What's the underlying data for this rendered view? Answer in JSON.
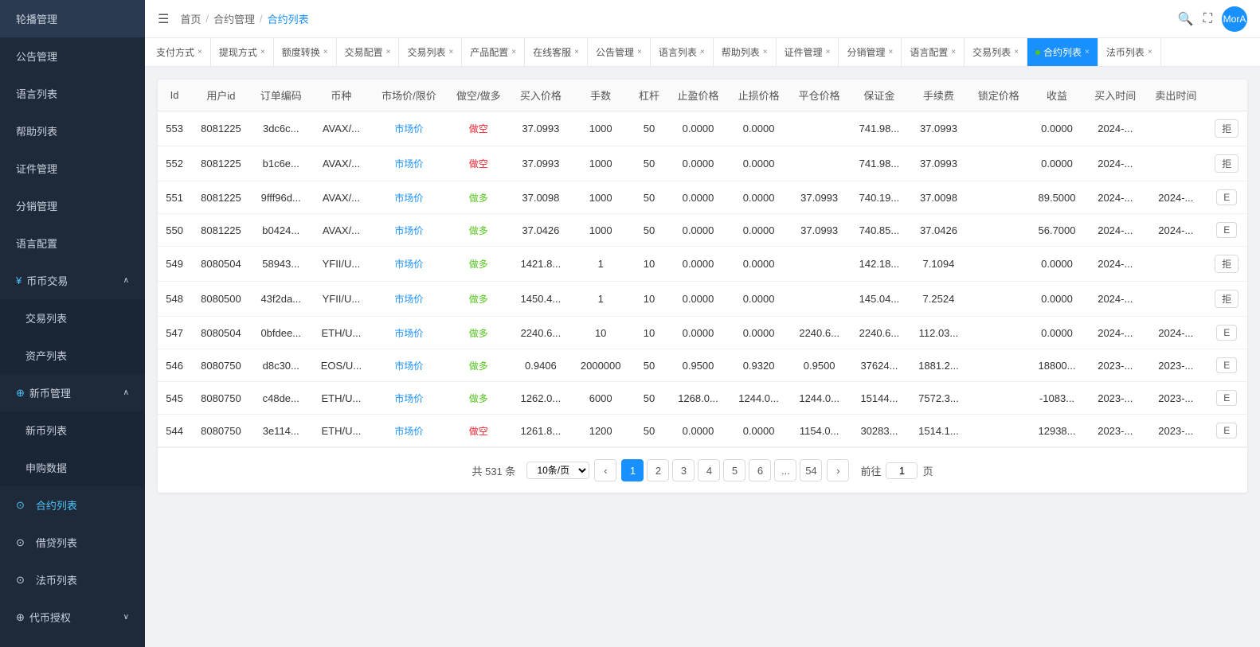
{
  "sidebar": {
    "items": [
      {
        "label": "轮播管理",
        "key": "banner",
        "active": false
      },
      {
        "label": "公告管理",
        "key": "notice",
        "active": false
      },
      {
        "label": "语言列表",
        "key": "language-list",
        "active": false
      },
      {
        "label": "帮助列表",
        "key": "help-list",
        "active": false
      },
      {
        "label": "证件管理",
        "key": "cert",
        "active": false
      },
      {
        "label": "分销管理",
        "key": "distribution",
        "active": false
      },
      {
        "label": "语言配置",
        "key": "lang-config",
        "active": false
      }
    ],
    "sections": [
      {
        "label": "币币交易",
        "key": "coin-trade",
        "expanded": true,
        "sub": [
          {
            "label": "交易列表",
            "key": "trade-list",
            "active": false
          },
          {
            "label": "资产列表",
            "key": "asset-list",
            "active": false
          }
        ]
      },
      {
        "label": "新币管理",
        "key": "new-coin",
        "expanded": true,
        "sub": [
          {
            "label": "新币列表",
            "key": "new-coin-list",
            "active": false
          },
          {
            "label": "申购数据",
            "key": "subscribe-data",
            "active": false
          }
        ]
      },
      {
        "label": "合约列表",
        "key": "contract-list-menu",
        "active": true
      },
      {
        "label": "借贷列表",
        "key": "loan-list"
      },
      {
        "label": "法币列表",
        "key": "fiat-list"
      },
      {
        "label": "代币授权",
        "key": "token-auth",
        "expanded": false
      }
    ]
  },
  "topbar": {
    "breadcrumbs": [
      "首页",
      "合约管理",
      "合约列表"
    ],
    "search_icon": "🔍",
    "fullscreen_icon": "⛶",
    "user_label": "MorA"
  },
  "tabs": [
    {
      "label": "支付方式",
      "active": false
    },
    {
      "label": "提现方式",
      "active": false
    },
    {
      "label": "额度转换",
      "active": false
    },
    {
      "label": "交易配置",
      "active": false
    },
    {
      "label": "交易列表",
      "active": false
    },
    {
      "label": "产品配置",
      "active": false
    },
    {
      "label": "在线客服",
      "active": false
    },
    {
      "label": "公告管理",
      "active": false
    },
    {
      "label": "语言列表",
      "active": false
    },
    {
      "label": "帮助列表",
      "active": false
    },
    {
      "label": "证件管理",
      "active": false
    },
    {
      "label": "分销管理",
      "active": false
    },
    {
      "label": "语言配置",
      "active": false
    },
    {
      "label": "交易列表",
      "active": false
    },
    {
      "label": "合约列表",
      "active": true,
      "dot": true
    },
    {
      "label": "法币列表",
      "active": false
    }
  ],
  "table": {
    "columns": [
      "Id",
      "用户id",
      "订单编码",
      "币种",
      "市场价/限价",
      "做空/做多",
      "买入价格",
      "手数",
      "杠杆",
      "止盈价格",
      "止损价格",
      "平仓价格",
      "保证金",
      "手续费",
      "锁定价格",
      "收益",
      "买入时间",
      "卖出时间"
    ],
    "rows": [
      {
        "id": "553",
        "user_id": "8081225",
        "order_code": "3dc6c...",
        "coin": "AVAX/...",
        "price_type": "市场价",
        "direction": "做空",
        "direction_type": "short",
        "buy_price": "37.0993",
        "lots": "1000",
        "leverage": "50",
        "stop_profit": "0.0000",
        "stop_loss": "0.0000",
        "close_price": "",
        "margin": "741.98...",
        "fee": "37.0993",
        "lock_price": "",
        "profit": "0.0000",
        "buy_time": "2024-...",
        "sell_time": "",
        "action": "拒"
      },
      {
        "id": "552",
        "user_id": "8081225",
        "order_code": "b1c6e...",
        "coin": "AVAX/...",
        "price_type": "市场价",
        "direction": "做空",
        "direction_type": "short",
        "buy_price": "37.0993",
        "lots": "1000",
        "leverage": "50",
        "stop_profit": "0.0000",
        "stop_loss": "0.0000",
        "close_price": "",
        "margin": "741.98...",
        "fee": "37.0993",
        "lock_price": "",
        "profit": "0.0000",
        "buy_time": "2024-...",
        "sell_time": "",
        "action": "拒"
      },
      {
        "id": "551",
        "user_id": "8081225",
        "order_code": "9fff96d...",
        "coin": "AVAX/...",
        "price_type": "市场价",
        "direction": "做多",
        "direction_type": "long",
        "buy_price": "37.0098",
        "lots": "1000",
        "leverage": "50",
        "stop_profit": "0.0000",
        "stop_loss": "0.0000",
        "close_price": "37.0993",
        "margin": "740.19...",
        "fee": "37.0098",
        "lock_price": "",
        "profit": "89.5000",
        "buy_time": "2024-...",
        "sell_time": "2024-...",
        "action": "E"
      },
      {
        "id": "550",
        "user_id": "8081225",
        "order_code": "b0424...",
        "coin": "AVAX/...",
        "price_type": "市场价",
        "direction": "做多",
        "direction_type": "long",
        "buy_price": "37.0426",
        "lots": "1000",
        "leverage": "50",
        "stop_profit": "0.0000",
        "stop_loss": "0.0000",
        "close_price": "37.0993",
        "margin": "740.85...",
        "fee": "37.0426",
        "lock_price": "",
        "profit": "56.7000",
        "buy_time": "2024-...",
        "sell_time": "2024-...",
        "action": "E"
      },
      {
        "id": "549",
        "user_id": "8080504",
        "order_code": "58943...",
        "coin": "YFII/U...",
        "price_type": "市场价",
        "direction": "做多",
        "direction_type": "long",
        "buy_price": "1421.8...",
        "lots": "1",
        "leverage": "10",
        "stop_profit": "0.0000",
        "stop_loss": "0.0000",
        "close_price": "",
        "margin": "142.18...",
        "fee": "7.1094",
        "lock_price": "",
        "profit": "0.0000",
        "buy_time": "2024-...",
        "sell_time": "",
        "action": "拒"
      },
      {
        "id": "548",
        "user_id": "8080500",
        "order_code": "43f2da...",
        "coin": "YFII/U...",
        "price_type": "市场价",
        "direction": "做多",
        "direction_type": "long",
        "buy_price": "1450.4...",
        "lots": "1",
        "leverage": "10",
        "stop_profit": "0.0000",
        "stop_loss": "0.0000",
        "close_price": "",
        "margin": "145.04...",
        "fee": "7.2524",
        "lock_price": "",
        "profit": "0.0000",
        "buy_time": "2024-...",
        "sell_time": "",
        "action": "拒"
      },
      {
        "id": "547",
        "user_id": "8080504",
        "order_code": "0bfdee...",
        "coin": "ETH/U...",
        "price_type": "市场价",
        "direction": "做多",
        "direction_type": "long",
        "buy_price": "2240.6...",
        "lots": "10",
        "leverage": "10",
        "stop_profit": "0.0000",
        "stop_loss": "0.0000",
        "close_price": "2240.6...",
        "margin": "2240.6...",
        "fee": "112.03...",
        "lock_price": "",
        "profit": "0.0000",
        "buy_time": "2024-...",
        "sell_time": "2024-...",
        "action": "E"
      },
      {
        "id": "546",
        "user_id": "8080750",
        "order_code": "d8c30...",
        "coin": "EOS/U...",
        "price_type": "市场价",
        "direction": "做多",
        "direction_type": "long",
        "buy_price": "0.9406",
        "lots": "2000000",
        "leverage": "50",
        "stop_profit": "0.9500",
        "stop_loss": "0.9320",
        "close_price": "0.9500",
        "margin": "37624...",
        "fee": "1881.2...",
        "lock_price": "",
        "profit": "18800...",
        "buy_time": "2023-...",
        "sell_time": "2023-...",
        "action": "E"
      },
      {
        "id": "545",
        "user_id": "8080750",
        "order_code": "c48de...",
        "coin": "ETH/U...",
        "price_type": "市场价",
        "direction": "做多",
        "direction_type": "long",
        "buy_price": "1262.0...",
        "lots": "6000",
        "leverage": "50",
        "stop_profit": "1268.0...",
        "stop_loss": "1244.0...",
        "close_price": "1244.0...",
        "margin": "15144...",
        "fee": "7572.3...",
        "lock_price": "",
        "profit": "-1083...",
        "buy_time": "2023-...",
        "sell_time": "2023-...",
        "action": "E"
      },
      {
        "id": "544",
        "user_id": "8080750",
        "order_code": "3e114...",
        "coin": "ETH/U...",
        "price_type": "市场价",
        "direction": "做空",
        "direction_type": "short",
        "buy_price": "1261.8...",
        "lots": "1200",
        "leverage": "50",
        "stop_profit": "0.0000",
        "stop_loss": "0.0000",
        "close_price": "1154.0...",
        "margin": "30283...",
        "fee": "1514.1...",
        "lock_price": "",
        "profit": "12938...",
        "buy_time": "2023-...",
        "sell_time": "2023-...",
        "action": "E"
      }
    ]
  },
  "pagination": {
    "total_text": "共 531 条",
    "page_size_label": "10条/页",
    "prev_icon": "‹",
    "next_icon": "›",
    "pages": [
      "1",
      "2",
      "3",
      "4",
      "5",
      "6",
      "...",
      "54"
    ],
    "current_page": "1",
    "jump_label_before": "前往",
    "jump_value": "1",
    "jump_label_after": "页"
  }
}
